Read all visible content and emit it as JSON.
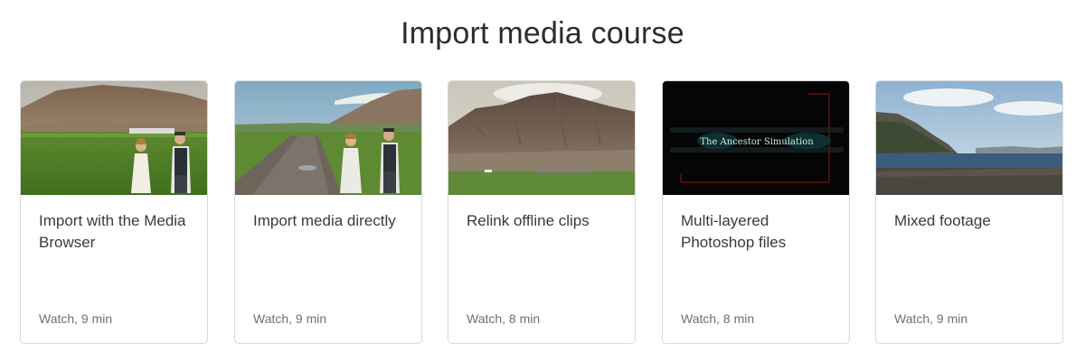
{
  "page": {
    "title": "Import media course"
  },
  "cards": [
    {
      "title": "Import with the Media Browser",
      "meta": "Watch, 9 min",
      "thumbnail": "couple-in-field-mountains"
    },
    {
      "title": "Import media directly",
      "meta": "Watch, 9 min",
      "thumbnail": "couple-on-dirt-road"
    },
    {
      "title": "Relink offline clips",
      "meta": "Watch, 8 min",
      "thumbnail": "cloudy-mountain-range"
    },
    {
      "title": "Multi-layered Photoshop files",
      "meta": "Watch, 8 min",
      "thumbnail": "title-graphic",
      "thumbnail_text": "The Ancestor Simulation"
    },
    {
      "title": "Mixed footage",
      "meta": "Watch, 9 min",
      "thumbnail": "coastal-cliffs-lake"
    }
  ]
}
